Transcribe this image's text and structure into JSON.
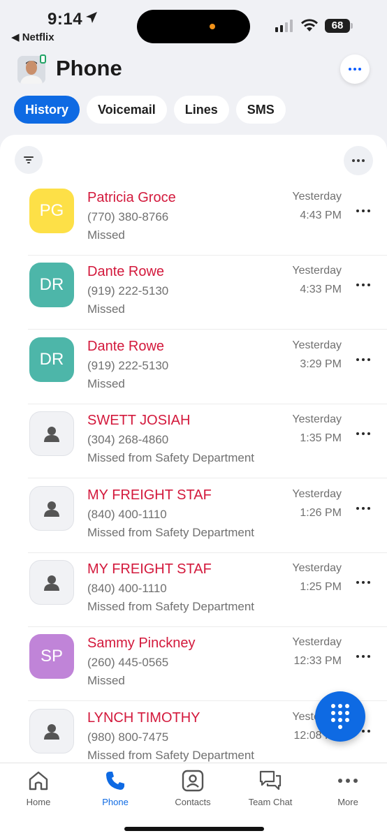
{
  "status_bar": {
    "time": "9:14",
    "back_app": "◀ Netflix",
    "battery": "68"
  },
  "header": {
    "title": "Phone"
  },
  "tabs": [
    {
      "label": "History",
      "active": true
    },
    {
      "label": "Voicemail",
      "active": false
    },
    {
      "label": "Lines",
      "active": false
    },
    {
      "label": "SMS",
      "active": false
    }
  ],
  "calls": [
    {
      "initials": "PG",
      "avatar_color": "#fde047",
      "name": "Patricia Groce",
      "number": "(770) 380-8766",
      "status": "Missed",
      "date": "Yesterday",
      "time": "4:43 PM"
    },
    {
      "initials": "DR",
      "avatar_color": "#4db6a9",
      "name": "Dante Rowe",
      "number": "(919) 222-5130",
      "status": "Missed",
      "date": "Yesterday",
      "time": "4:33 PM"
    },
    {
      "initials": "DR",
      "avatar_color": "#4db6a9",
      "name": "Dante Rowe",
      "number": "(919) 222-5130",
      "status": "Missed",
      "date": "Yesterday",
      "time": "3:29 PM"
    },
    {
      "initials": "",
      "avatar_color": "",
      "name": "SWETT JOSIAH",
      "number": "(304) 268-4860",
      "status": "Missed from Safety Department",
      "date": "Yesterday",
      "time": "1:35 PM"
    },
    {
      "initials": "",
      "avatar_color": "",
      "name": "MY FREIGHT STAF",
      "number": "(840) 400-1110",
      "status": "Missed from Safety Department",
      "date": "Yesterday",
      "time": "1:26 PM"
    },
    {
      "initials": "",
      "avatar_color": "",
      "name": "MY FREIGHT STAF",
      "number": "(840) 400-1110",
      "status": "Missed from Safety Department",
      "date": "Yesterday",
      "time": "1:25 PM"
    },
    {
      "initials": "SP",
      "avatar_color": "#c084d8",
      "name": "Sammy Pinckney",
      "number": "(260) 445-0565",
      "status": "Missed",
      "date": "Yesterday",
      "time": "12:33 PM"
    },
    {
      "initials": "",
      "avatar_color": "",
      "name": "LYNCH TIMOTHY",
      "number": "(980) 800-7475",
      "status": "Missed from Safety Department",
      "date": "Yesterday",
      "time": "12:08 PM"
    }
  ],
  "bottom_nav": [
    {
      "label": "Home",
      "icon": "home-icon",
      "active": false
    },
    {
      "label": "Phone",
      "icon": "phone-icon",
      "active": true
    },
    {
      "label": "Contacts",
      "icon": "contacts-icon",
      "active": false
    },
    {
      "label": "Team Chat",
      "icon": "team-chat-icon",
      "active": false
    },
    {
      "label": "More",
      "icon": "more-icon",
      "active": false
    }
  ],
  "colors": {
    "accent": "#0e6ae3",
    "missed": "#d3193c"
  }
}
